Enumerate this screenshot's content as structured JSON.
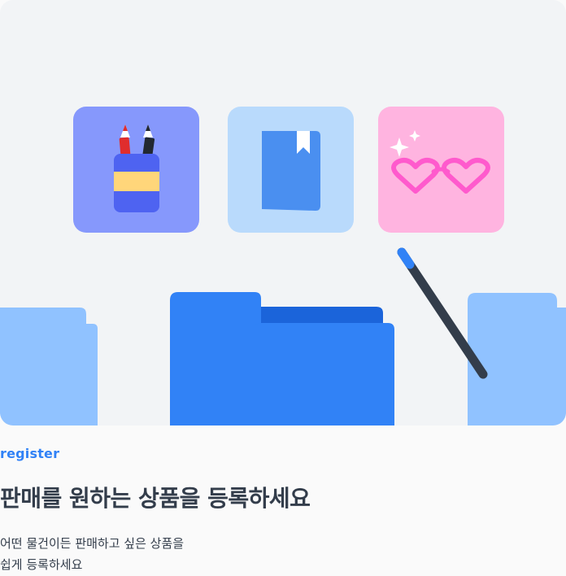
{
  "hero": {
    "tiles": [
      "pencil-cup-icon",
      "book-bookmark-icon",
      "heart-glasses-icon"
    ],
    "colors": {
      "background": "#f2f4f6",
      "pencils_tile": "#8698fc",
      "book_tile": "#b9dafc",
      "glasses_tile": "#ffb4e0",
      "folder_primary": "#3182f6",
      "folder_light": "#90c2ff"
    }
  },
  "content": {
    "kicker": "register",
    "headline": "판매를 원하는 상품을 등록하세요",
    "description": [
      "어떤 물건이든 판매하고 싶은 상품을",
      "쉽게 등록하세요"
    ]
  }
}
